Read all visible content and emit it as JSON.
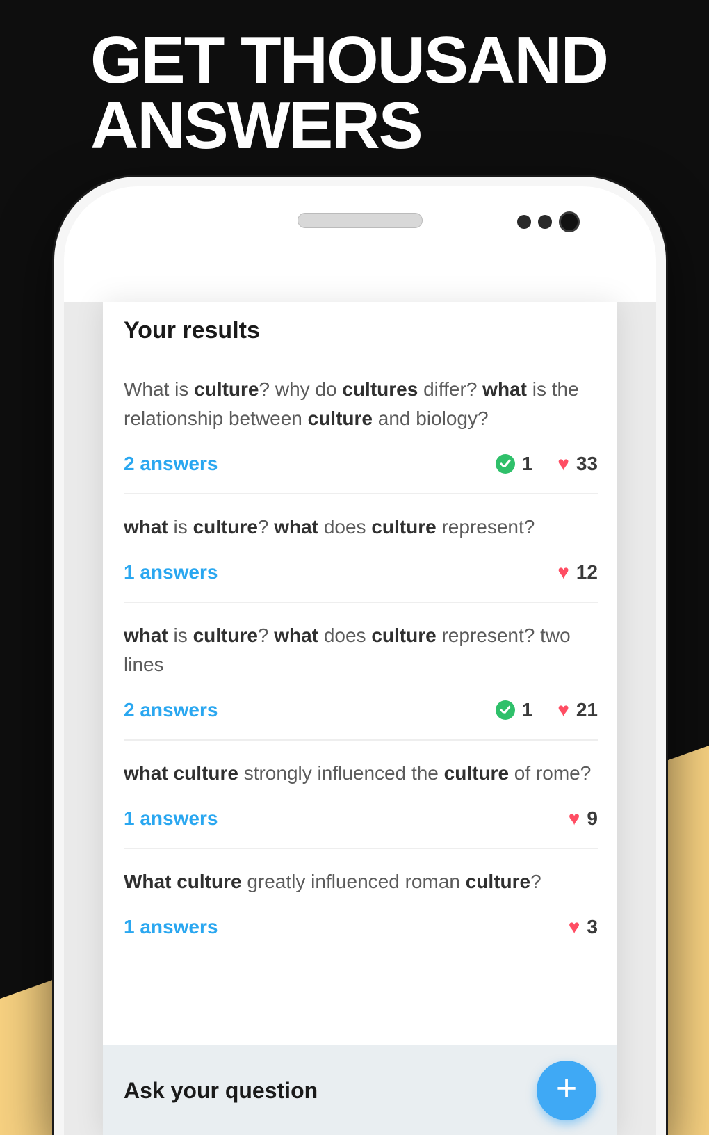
{
  "headline": {
    "line1": "GET THOUSAND",
    "line2": "ANSWERS"
  },
  "screen": {
    "results_heading": "Your results",
    "items": [
      {
        "question_html": "What is <b>culture</b>? why do <b>cultures</b> differ? <b>what</b> is the relationship between <b>culture</b> and biology?",
        "answers_label": "2 answers",
        "verified": "1",
        "hearts": "33"
      },
      {
        "question_html": "<b>what</b> is <b>culture</b>? <b>what</b> does <b>culture</b> represent?",
        "answers_label": "1 answers",
        "verified": "",
        "hearts": "12"
      },
      {
        "question_html": "<b>what</b> is <b>culture</b>? <b>what</b> does <b>culture</b> represent? two lines",
        "answers_label": "2 answers",
        "verified": "1",
        "hearts": "21"
      },
      {
        "question_html": "<b>what culture</b> strongly influenced the <b>culture</b> of rome?",
        "answers_label": "1 answers",
        "verified": "",
        "hearts": "9"
      },
      {
        "question_html": "<b>What culture</b> greatly influenced roman <b>culture</b>?",
        "answers_label": "1 answers",
        "verified": "",
        "hearts": "3"
      }
    ],
    "ask_bar_label": "Ask your question"
  }
}
